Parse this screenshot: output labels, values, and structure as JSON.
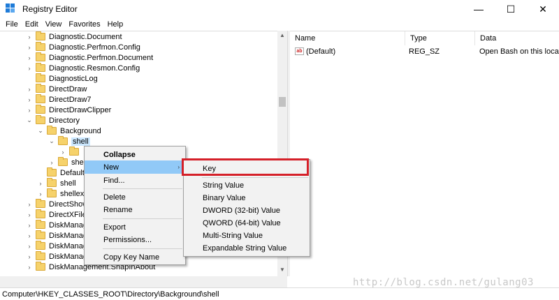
{
  "window": {
    "title": "Registry Editor",
    "minimize": "—",
    "maximize": "☐",
    "close": "✕"
  },
  "menubar": [
    "File",
    "Edit",
    "View",
    "Favorites",
    "Help"
  ],
  "tree": {
    "items": [
      {
        "label": "Diagnostic.Document",
        "chevron": "›"
      },
      {
        "label": "Diagnostic.Perfmon.Config",
        "chevron": "›"
      },
      {
        "label": "Diagnostic.Perfmon.Document",
        "chevron": "›"
      },
      {
        "label": "Diagnostic.Resmon.Config",
        "chevron": "›"
      },
      {
        "label": "DiagnosticLog",
        "chevron": ""
      },
      {
        "label": "DirectDraw",
        "chevron": "›"
      },
      {
        "label": "DirectDraw7",
        "chevron": "›"
      },
      {
        "label": "DirectDrawClipper",
        "chevron": "›"
      },
      {
        "label": "Directory",
        "chevron": "⌄"
      },
      {
        "label": "Background",
        "chevron": "⌄"
      },
      {
        "label": "shell",
        "chevron": "⌄"
      },
      {
        "label": "",
        "chevron": "›"
      },
      {
        "label": "she",
        "chevron": "›"
      },
      {
        "label": "Default",
        "chevron": ""
      },
      {
        "label": "shell",
        "chevron": "›"
      },
      {
        "label": "shellex",
        "chevron": "›"
      },
      {
        "label": "DirectShow",
        "chevron": "›"
      },
      {
        "label": "DirectXFile",
        "chevron": "›"
      },
      {
        "label": "DiskManag",
        "chevron": "›"
      },
      {
        "label": "DiskManag",
        "chevron": "›"
      },
      {
        "label": "DiskManag",
        "chevron": "›"
      },
      {
        "label": "DiskManag",
        "chevron": "›"
      },
      {
        "label": "DiskManagement.SnapInAbout",
        "chevron": "›"
      }
    ]
  },
  "list": {
    "columns": [
      "Name",
      "Type",
      "Data"
    ],
    "rows": [
      {
        "icon": "ab",
        "name": "(Default)",
        "type": "REG_SZ",
        "data": "Open Bash on this locatio"
      }
    ]
  },
  "context_menu": {
    "items": [
      "Collapse",
      "New",
      "Find...",
      "Delete",
      "Rename",
      "Export",
      "Permissions...",
      "Copy Key Name"
    ],
    "new_arrow": "›"
  },
  "submenu": {
    "items": [
      "Key",
      "String Value",
      "Binary Value",
      "DWORD (32-bit) Value",
      "QWORD (64-bit) Value",
      "Multi-String Value",
      "Expandable String Value"
    ]
  },
  "statusbar": {
    "path": "Computer\\HKEY_CLASSES_ROOT\\Directory\\Background\\shell"
  },
  "watermark": "http://blog.csdn.net/gulang03",
  "colors": {
    "highlight_red": "#d52029",
    "menu_hover": "#91c9f7",
    "folder": "#f6d26b"
  }
}
